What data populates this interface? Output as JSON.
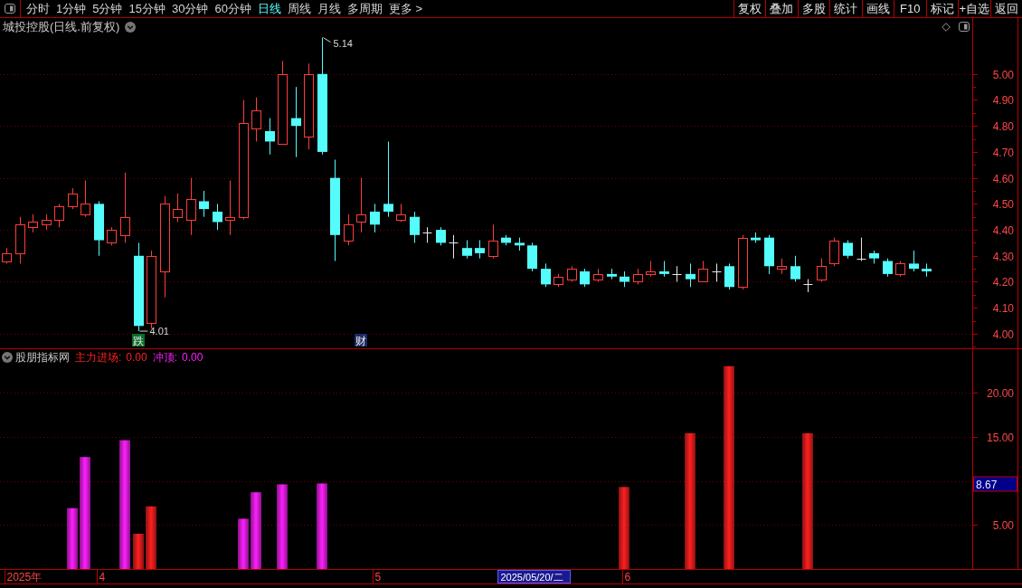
{
  "toolbar": {
    "tabs": [
      {
        "label": "分时",
        "selected": false
      },
      {
        "label": "1分钟",
        "selected": false
      },
      {
        "label": "5分钟",
        "selected": false
      },
      {
        "label": "15分钟",
        "selected": false
      },
      {
        "label": "30分钟",
        "selected": false
      },
      {
        "label": "60分钟",
        "selected": false
      },
      {
        "label": "日线",
        "selected": true
      },
      {
        "label": "周线",
        "selected": false
      },
      {
        "label": "月线",
        "selected": false
      },
      {
        "label": "多周期",
        "selected": false
      },
      {
        "label": "更多 >",
        "selected": false
      }
    ],
    "buttons": [
      "复权",
      "叠加",
      "多股",
      "统计",
      "画线",
      "F10",
      "标记",
      "+自选",
      "返回"
    ]
  },
  "price_panel": {
    "title": "城投控股(日线.前复权)",
    "axis_labels": [
      "5.00",
      "4.90",
      "4.80",
      "4.70",
      "4.60",
      "4.50",
      "4.40",
      "4.30",
      "4.20",
      "4.10",
      "4.00"
    ],
    "markers": [
      {
        "kind": "high",
        "text": "5.14"
      },
      {
        "kind": "low",
        "text": "4.01"
      }
    ],
    "tags": [
      {
        "text": "跌",
        "color": "#0a6e2a"
      },
      {
        "text": "财",
        "color": "#1c2a66"
      }
    ]
  },
  "indicator_panel": {
    "title": "股朋指标网",
    "legend": [
      {
        "label": "主力进场:",
        "value": "0.00"
      },
      {
        "label": "冲顶:",
        "value": "0.00"
      }
    ],
    "chart_data": {
      "type": "bar",
      "ylim": [
        0,
        23.18
      ],
      "yticks": [
        {
          "value": 5,
          "label": "5.00"
        },
        {
          "value": 15,
          "label": "15.00"
        },
        {
          "value": 20,
          "label": "20.00"
        }
      ],
      "grid": true,
      "series": [
        {
          "color": "#ff2020",
          "values": [
            0,
            0,
            0,
            0,
            0,
            0,
            0,
            0,
            0,
            0,
            4,
            7.1,
            0,
            0,
            0,
            0,
            0,
            0,
            0,
            0,
            0,
            0,
            0,
            0,
            0,
            0,
            0,
            0,
            0,
            0,
            0,
            0,
            0,
            0,
            0,
            0,
            0,
            0,
            0,
            0,
            0,
            0,
            0,
            0,
            0,
            0,
            0,
            9.3,
            0,
            0,
            0,
            0,
            15.4,
            0,
            0,
            23,
            0,
            0,
            0,
            0,
            0,
            15.4,
            0,
            0,
            0,
            0,
            0,
            0,
            0,
            0,
            0,
            0,
            0,
            0
          ]
        },
        {
          "color": "#ff20ff",
          "values": [
            0,
            0,
            0,
            0,
            0,
            6.9,
            12.7,
            0,
            0,
            14.6,
            0,
            0,
            0,
            0,
            0,
            0,
            0,
            0,
            5.7,
            8.7,
            0,
            9.6,
            0,
            0,
            9.7,
            0,
            0,
            0,
            0,
            0,
            0,
            0,
            0,
            0,
            0,
            0,
            0,
            0,
            0,
            0,
            0,
            0,
            0,
            0,
            0,
            0,
            0,
            0,
            0,
            0,
            0,
            0,
            0,
            0,
            0,
            0,
            0,
            0,
            0,
            0,
            0,
            0,
            0,
            0,
            0,
            0,
            0,
            0,
            0,
            0,
            0,
            0,
            0,
            0
          ]
        }
      ],
      "annotations": [
        "8.67"
      ]
    },
    "date_axis": {
      "labels": [
        "2025年",
        "4",
        "5",
        "6"
      ],
      "cursor_date": "2025/05/20/二"
    }
  }
}
